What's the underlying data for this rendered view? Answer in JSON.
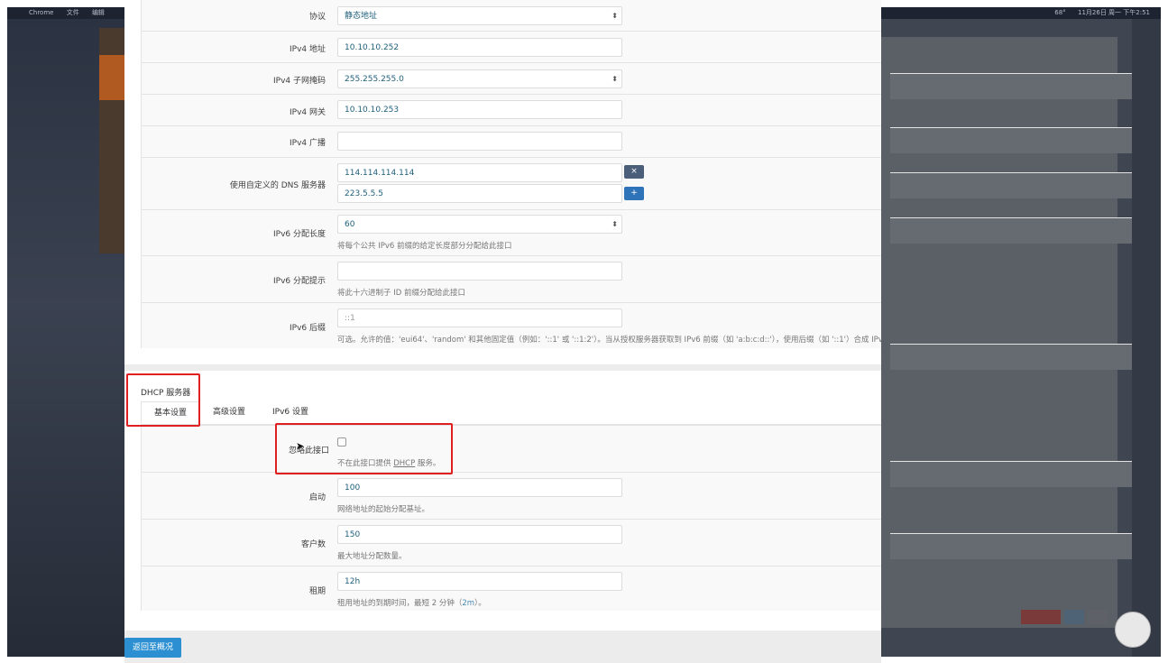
{
  "menubar": {
    "apple": "",
    "app": "Chrome",
    "items": [
      "文件",
      "编辑"
    ],
    "status": "68°",
    "clock": "11月26日 周一 下午2:51"
  },
  "general": {
    "protocol": {
      "label": "协议",
      "value": "静态地址"
    },
    "ipv4_addr": {
      "label": "IPv4 地址",
      "value": "10.10.10.252"
    },
    "ipv4_mask": {
      "label": "IPv4 子网掩码",
      "value": "255.255.255.0"
    },
    "ipv4_gw": {
      "label": "IPv4 网关",
      "value": "10.10.10.253"
    },
    "ipv4_bcast": {
      "label": "IPv4 广播",
      "value": ""
    },
    "dns": {
      "label": "使用自定义的 DNS 服务器",
      "values": [
        "114.114.114.114",
        "223.5.5.5"
      ],
      "remove": "×",
      "add": "+"
    },
    "ipv6_len": {
      "label": "IPv6 分配长度",
      "value": "60",
      "hint": "将每个公共 IPv6 前缀的给定长度部分分配给此接口"
    },
    "ipv6_hint": {
      "label": "IPv6 分配提示",
      "value": "",
      "hint": "将此十六进制子 ID 前缀分配给此接口"
    },
    "ipv6_suffix": {
      "label": "IPv6 后缀",
      "placeholder": "::1",
      "hint": "可选。允许的值：'eui64'、'random' 和其他固定值（例如：'::1' 或 '::1:2'）。当从授权服务器获取到 IPv6 前缀（如 'a:b:c:d::'），使用后缀（如 '::1'）合成 IPv"
    }
  },
  "dhcp": {
    "title": "DHCP 服务器",
    "tabs": [
      "基本设置",
      "高级设置",
      "IPv6 设置"
    ],
    "ignore": {
      "label": "忽略此接口",
      "hint_pre": "不在此接口提供 ",
      "hint_link": "DHCP",
      "hint_post": " 服务。",
      "checked": false
    },
    "start": {
      "label": "启动",
      "value": "100",
      "hint": "网络地址的起始分配基址。"
    },
    "limit": {
      "label": "客户数",
      "value": "150",
      "hint": "最大地址分配数量。"
    },
    "lease": {
      "label": "租期",
      "value": "12h",
      "hint_pre": "租用地址的到期时间，最短 2 分钟（",
      "hint_code": "2m",
      "hint_post": "）。"
    }
  },
  "footer": {
    "back": "返回至概况"
  },
  "colors": {
    "accent": "#2b8fd1",
    "highlight": "#e02020",
    "add_button": "#2f73b8"
  }
}
